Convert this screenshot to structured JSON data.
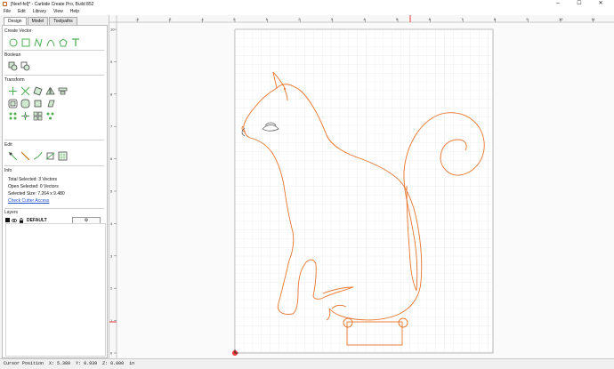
{
  "window": {
    "title": "[Neef-fel]* - Carbide Create Pro, Build 852",
    "minimize": "─",
    "maximize": "☐",
    "close": "✕"
  },
  "menu": [
    "File",
    "Edit",
    "Library",
    "View",
    "Help"
  ],
  "tabs": [
    "Design",
    "Model",
    "Toolpaths"
  ],
  "sections": {
    "create_vector": "Create Vector",
    "boolean": "Boolean",
    "transform": "Transform",
    "edit": "Edit",
    "info": "Info",
    "layers": "Layers"
  },
  "info": {
    "total_selected_label": "Total Selected:",
    "total_selected_value": "3 Vectors",
    "open_selected_label": "Open Selected:",
    "open_selected_value": "0 Vectors",
    "selected_size_label": "Selected Size:",
    "selected_size_value": "7.264 x 9.480",
    "cutter_link": "Check Cutter Access"
  },
  "layers": {
    "default_name": "DEFAULT",
    "add_button": "+",
    "settings_button": "⚙"
  },
  "ruler": {
    "h_labels": [
      "-3",
      "-2",
      "-1",
      "0",
      "1",
      "2",
      "3",
      "4",
      "5",
      "6",
      "7",
      "8",
      "9",
      "10",
      "11"
    ],
    "v_labels": [
      "10",
      "9",
      "8",
      "7",
      "6",
      "5",
      "4",
      "3",
      "2",
      "1",
      "0"
    ]
  },
  "status": {
    "label": "Cursor Position",
    "x": "X: 5.380",
    "y": "Y: 0.939",
    "z": "Z: 0.000",
    "unit": "in"
  },
  "colors": {
    "vector": "#e8742c",
    "accent": "#4caf50",
    "grid": "#d9d9d9"
  }
}
